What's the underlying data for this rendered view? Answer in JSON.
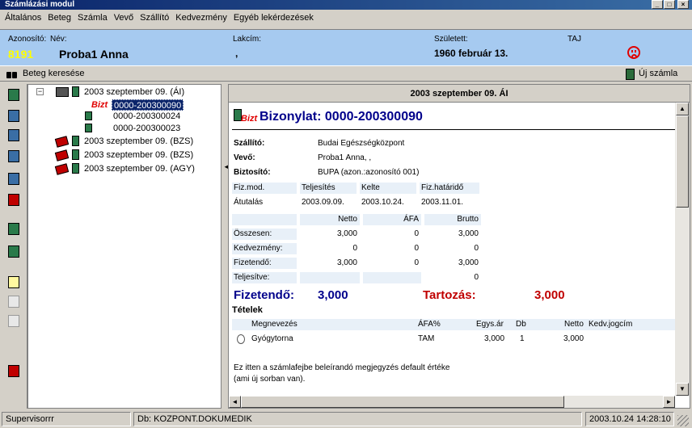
{
  "window": {
    "title": "Számlázási modul",
    "min": "_",
    "max": "□",
    "close": "×"
  },
  "menu": [
    "Általános",
    "Beteg",
    "Számla",
    "Vevő",
    "Szállító",
    "Kedvezmény",
    "Egyéb lekérdezések"
  ],
  "patient": {
    "id_label": "Azonosító:",
    "id_value": "8191",
    "name_label": "Név:",
    "name_value": "Proba1 Anna",
    "addr_label": "Lakcím:",
    "addr_value": ",",
    "born_label": "Született:",
    "born_value": "1960 február 13.",
    "taj_label": "TAJ"
  },
  "toolbar": {
    "search_label": "Beteg keresése",
    "new_invoice_label": "Új számla"
  },
  "tree": {
    "nodes": [
      {
        "label": "2003 szeptember 09. (ÁI)"
      },
      {
        "label": "0000-200300090",
        "badge": "Bizt"
      },
      {
        "label": "0000-200300024"
      },
      {
        "label": "0000-200300023"
      },
      {
        "label": "2003 szeptember 09. (BZS)"
      },
      {
        "label": "2003 szeptember 09. (BZS)"
      },
      {
        "label": "2003 szeptember 09. (AGY)"
      }
    ],
    "expander": "−"
  },
  "detail": {
    "header": "2003 szeptember 09.  ÁI",
    "badge": "Bizt",
    "doc_title": "Bizonylat: 0000-200300090",
    "supplier_label": "Szállító:",
    "supplier": "Budai Egészségközpont",
    "buyer_label": "Vevő:",
    "buyer": "Proba1 Anna,  ,",
    "insurer_label": "Biztosító:",
    "insurer": "BUPA (azon.:azonosító 001)",
    "pay_headers": [
      "Fiz.mod.",
      "Teljesítés",
      "Kelte",
      "Fiz.határidő"
    ],
    "pay_values": [
      "Átutalás",
      "2003.09.09.",
      "2003.10.24.",
      "2003.11.01."
    ],
    "sum_headers": [
      "Netto",
      "ÁFA",
      "Brutto"
    ],
    "sum_rows": [
      {
        "label": "Összesen:",
        "values": [
          "3,000",
          "0",
          "3,000"
        ]
      },
      {
        "label": "Kedvezmény:",
        "values": [
          "0",
          "0",
          "0"
        ]
      },
      {
        "label": "Fizetendő:",
        "values": [
          "3,000",
          "0",
          "3,000"
        ]
      },
      {
        "label": "Teljesítve:",
        "values": [
          "",
          "",
          "0"
        ]
      }
    ],
    "payable_label": "Fizetendő:",
    "payable_value": "3,000",
    "debt_label": "Tartozás:",
    "debt_value": "3,000",
    "items_label": "Tételek",
    "items_headers": [
      "Megnevezés",
      "ÁFA%",
      "Egys.ár",
      "Db",
      "Netto",
      "Kedv.jogcím"
    ],
    "items": [
      {
        "name": "Gyógytorna",
        "vat": "TAM",
        "unit": "3,000",
        "qty": "1",
        "net": "3,000",
        "discount": ""
      }
    ],
    "note": "Ez itten a számlafejbe beleírandó megjegyzés default értéke (ami új sorban van)."
  },
  "status": {
    "user": "Supervisorrr",
    "db": "Db: KOZPONT.DOKUMEDIK",
    "datetime": "2003.10.24 14:28:10"
  },
  "colors": {
    "patient_band": "#a6caf0",
    "id_yellow": "#ffff00",
    "doc_blue": "#00008b",
    "debt_red": "#c00000"
  }
}
